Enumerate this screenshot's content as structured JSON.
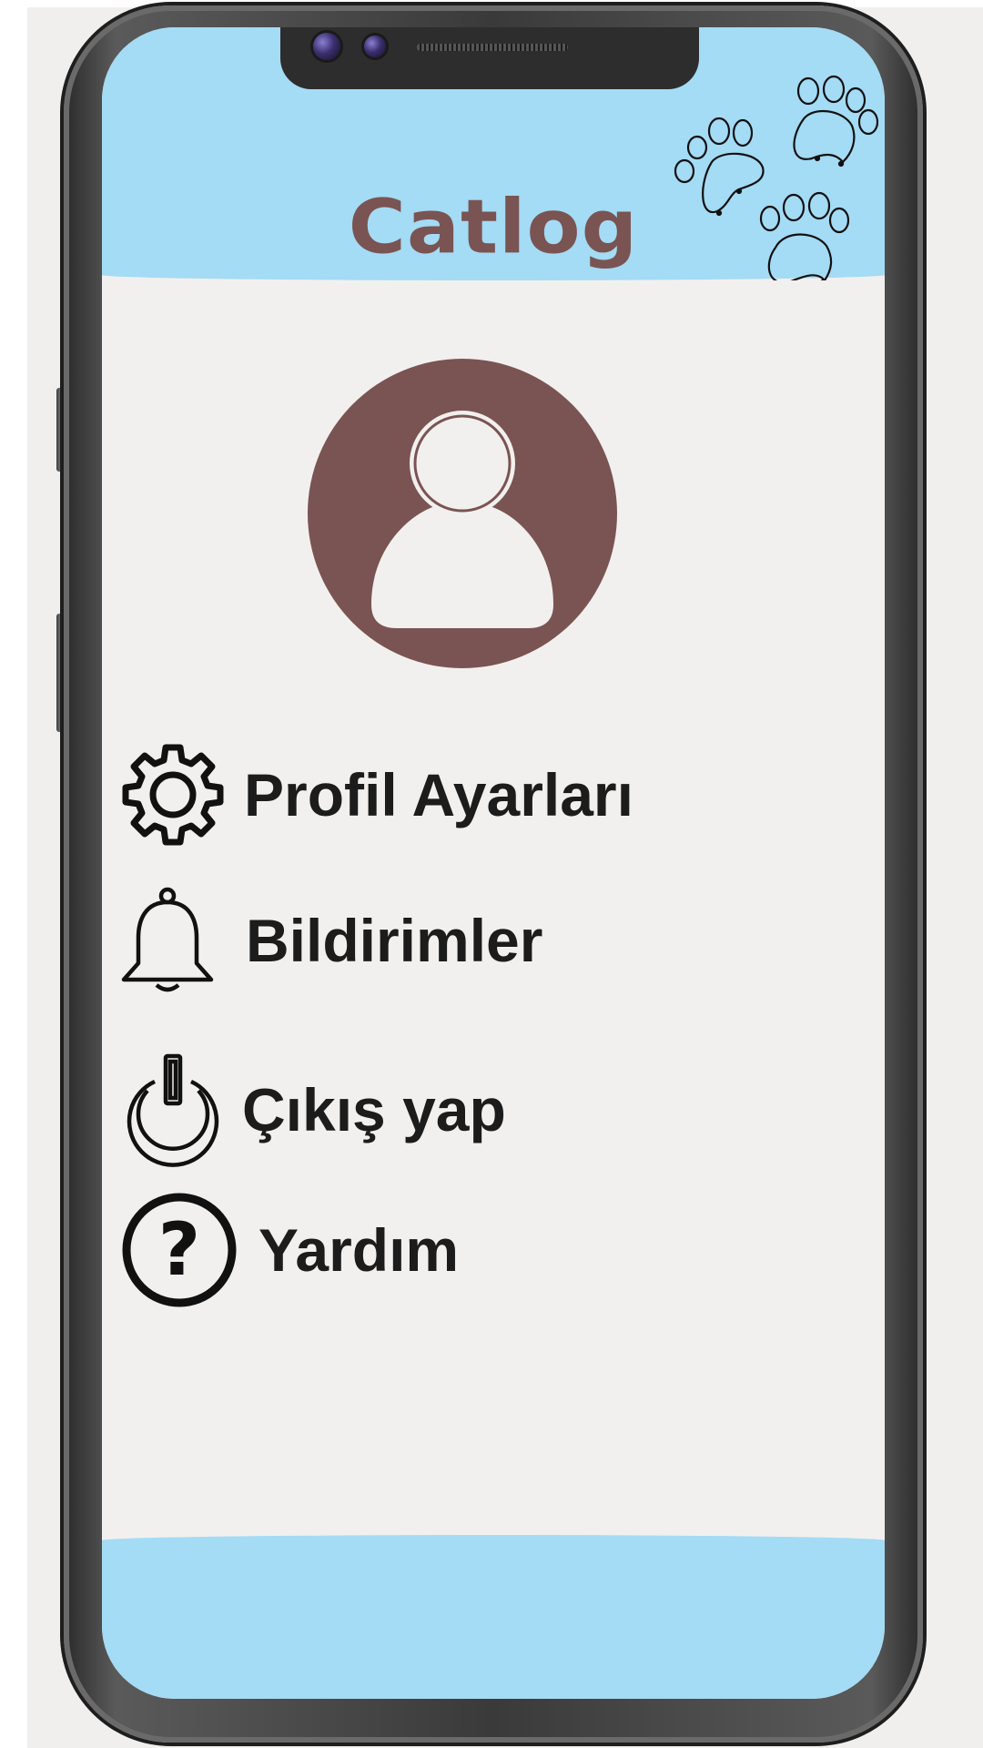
{
  "app": {
    "title": "Catlog"
  },
  "colors": {
    "accent": "#7a5452",
    "band": "#a4dbf5",
    "background": "#f2f0ee",
    "text": "#1c1c1c"
  },
  "menu": {
    "items": [
      {
        "label": "Profil Ayarları",
        "icon": "gear-icon"
      },
      {
        "label": "Bildirimler",
        "icon": "bell-icon"
      },
      {
        "label": "Çıkış yap",
        "icon": "power-icon"
      },
      {
        "label": "Yardım",
        "icon": "help-icon"
      }
    ]
  }
}
